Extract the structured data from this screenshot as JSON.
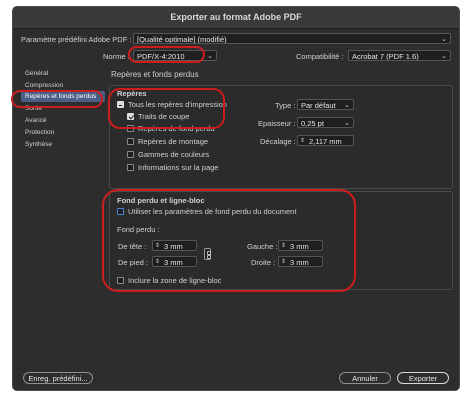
{
  "window": {
    "title": "Exporter au format Adobe PDF"
  },
  "preset": {
    "label": "Paramètre prédéfini Adobe PDF :",
    "value": "[Qualité optimale] (modifié)"
  },
  "standard": {
    "label": "Norme :",
    "value": "PDF/X-4:2010"
  },
  "compatibility": {
    "label": "Compatibilité :",
    "value": "Acrobat 7 (PDF 1.6)"
  },
  "sidebar": {
    "items": [
      {
        "label": "Général"
      },
      {
        "label": "Compression"
      },
      {
        "label": "Repères et fonds perdus",
        "selected": true
      },
      {
        "label": "Sortie"
      },
      {
        "label": "Avancé"
      },
      {
        "label": "Protection"
      },
      {
        "label": "Synthèse"
      }
    ]
  },
  "main": {
    "heading": "Repères et fonds perdus"
  },
  "marks": {
    "heading": "Repères",
    "all_marks": {
      "label": "Tous les repères d'impression",
      "state": "mixed"
    },
    "crop_marks": {
      "label": "Traits de coupe",
      "checked": true
    },
    "bleed_marks": {
      "label": "Repères de fond perdu",
      "checked": false
    },
    "registration_marks": {
      "label": "Repères de montage",
      "checked": false
    },
    "color_bars": {
      "label": "Gammes de couleurs",
      "checked": false
    },
    "page_info": {
      "label": "Informations sur la page",
      "checked": false
    },
    "type": {
      "label": "Type :",
      "value": "Par défaut"
    },
    "weight": {
      "label": "Epaisseur :",
      "value": "0,25 pt"
    },
    "offset": {
      "label": "Décalage :",
      "value": "2,117 mm"
    }
  },
  "bleed": {
    "heading": "Fond perdu et ligne-bloc",
    "use_document": {
      "label": "Utiliser les paramètres de fond perdu du document",
      "checked": false
    },
    "subheading": "Fond perdu :",
    "top": {
      "label": "De tête :",
      "value": "3 mm"
    },
    "bottom": {
      "label": "De pied :",
      "value": "3 mm"
    },
    "left": {
      "label": "Gauche :",
      "value": "3 mm"
    },
    "right": {
      "label": "Droite :",
      "value": "3 mm"
    },
    "slug": {
      "label": "Inclure la zone de ligne-bloc",
      "checked": false
    }
  },
  "footer": {
    "save_preset": "Enreg. prédéfini...",
    "cancel": "Annuler",
    "export": "Exporter"
  },
  "annotations": {
    "color": "#cc1e1e"
  }
}
